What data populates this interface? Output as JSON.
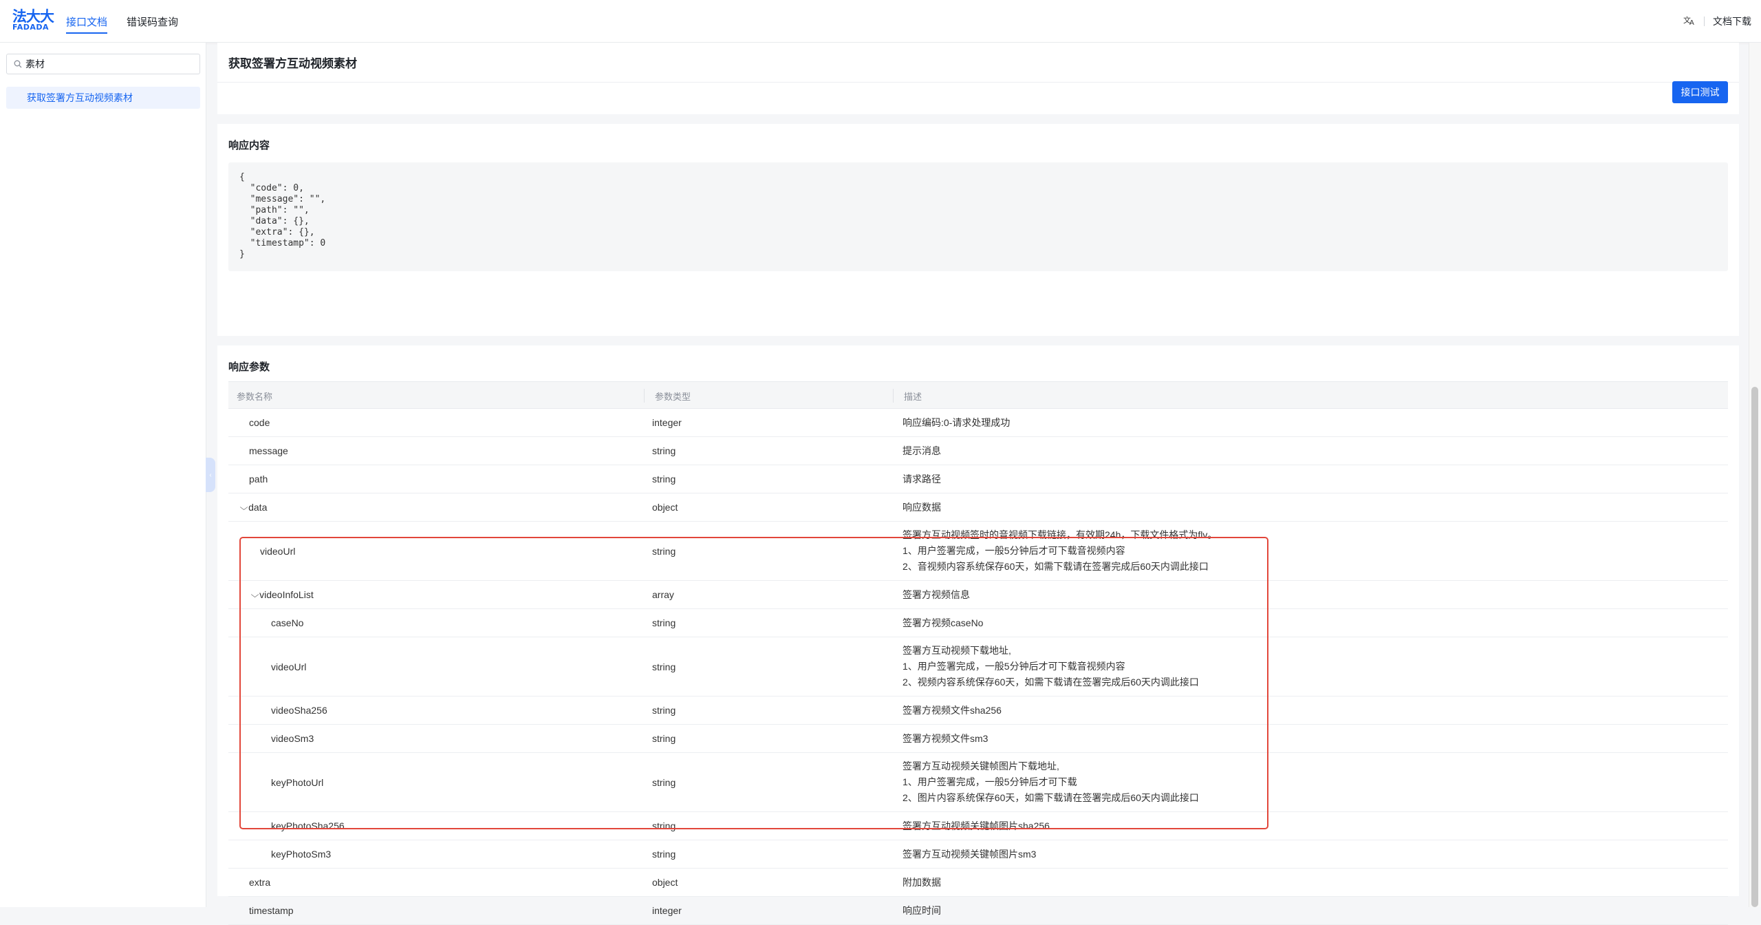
{
  "header": {
    "logo_cn": "法大大",
    "logo_en": "FADADA",
    "tabs": [
      {
        "label": "接口文档",
        "active": true
      },
      {
        "label": "错误码查询",
        "active": false
      }
    ],
    "doc_download": "文档下载"
  },
  "sidebar": {
    "search_value": "素材",
    "items": [
      {
        "label": "获取签署方互动视频素材",
        "active": true
      }
    ]
  },
  "main": {
    "page_title": "获取签署方互动视频素材",
    "test_button": "接口测试",
    "response_content": {
      "title": "响应内容",
      "code": "{\n  \"code\": 0,\n  \"message\": \"\",\n  \"path\": \"\",\n  \"data\": {},\n  \"extra\": {},\n  \"timestamp\": 0\n}"
    },
    "response_params": {
      "title": "响应参数",
      "columns": [
        "参数名称",
        "参数类型",
        "描述"
      ],
      "rows": [
        {
          "name": "code",
          "type": "integer",
          "desc": [
            "响应编码:0-请求处理成功"
          ],
          "indent": 0
        },
        {
          "name": "message",
          "type": "string",
          "desc": [
            "提示消息"
          ],
          "indent": 0
        },
        {
          "name": "path",
          "type": "string",
          "desc": [
            "请求路径"
          ],
          "indent": 0
        },
        {
          "name": "data",
          "type": "object",
          "desc": [
            "响应数据"
          ],
          "indent": 0,
          "toggle": true
        },
        {
          "name": "videoUrl",
          "type": "string",
          "desc": [
            "签署方互动视频签时的音视频下载链接，有效期24h，下载文件格式为flv。",
            "1、用户签署完成，一般5分钟后才可下载音视频内容",
            "2、音视频内容系统保存60天，如需下载请在签署完成后60天内调此接口"
          ],
          "indent": 1
        },
        {
          "name": "videoInfoList",
          "type": "array",
          "desc": [
            "签署方视频信息"
          ],
          "indent": 1,
          "toggle": true
        },
        {
          "name": "caseNo",
          "type": "string",
          "desc": [
            "签署方视频caseNo"
          ],
          "indent": 2
        },
        {
          "name": "videoUrl",
          "type": "string",
          "desc": [
            "签署方互动视频下载地址,",
            "1、用户签署完成，一般5分钟后才可下载音视频内容",
            "2、视频内容系统保存60天，如需下载请在签署完成后60天内调此接口"
          ],
          "indent": 2
        },
        {
          "name": "videoSha256",
          "type": "string",
          "desc": [
            "签署方视频文件sha256"
          ],
          "indent": 2
        },
        {
          "name": "videoSm3",
          "type": "string",
          "desc": [
            "签署方视频文件sm3"
          ],
          "indent": 2
        },
        {
          "name": "keyPhotoUrl",
          "type": "string",
          "desc": [
            "签署方互动视频关键帧图片下载地址,",
            "1、用户签署完成，一般5分钟后才可下载",
            "2、图片内容系统保存60天，如需下载请在签署完成后60天内调此接口"
          ],
          "indent": 2
        },
        {
          "name": "keyPhotoSha256",
          "type": "string",
          "desc": [
            "签署方互动视频关键帧图片sha256"
          ],
          "indent": 2
        },
        {
          "name": "keyPhotoSm3",
          "type": "string",
          "desc": [
            "签署方互动视频关键帧图片sm3"
          ],
          "indent": 2
        },
        {
          "name": "extra",
          "type": "object",
          "desc": [
            "附加数据"
          ],
          "indent": 0
        },
        {
          "name": "timestamp",
          "type": "integer",
          "desc": [
            "响应时间"
          ],
          "indent": 0
        }
      ]
    }
  },
  "colors": {
    "accent": "#1765f0",
    "highlight_border": "#e2463a"
  }
}
